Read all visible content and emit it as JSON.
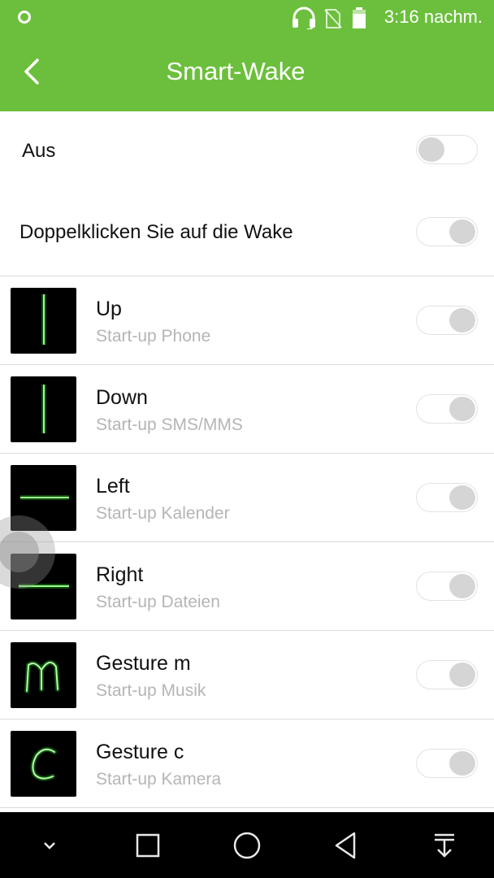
{
  "status_bar": {
    "time": "3:16 nachm.",
    "icons": [
      "notification-dot-icon",
      "headset-icon",
      "no-sim-icon",
      "battery-icon"
    ]
  },
  "app_bar": {
    "title": "Smart-Wake",
    "back_icon": "back-arrow-icon"
  },
  "settings": {
    "master": {
      "label": "Aus",
      "enabled": false
    },
    "double_click": {
      "label": "Doppelklicken Sie auf die Wake",
      "enabled": false
    }
  },
  "gestures": [
    {
      "title": "Up",
      "subtitle": "Start-up Phone",
      "thumb_icon": "vertical-line-gesture-icon",
      "enabled": false
    },
    {
      "title": "Down",
      "subtitle": "Start-up SMS/MMS",
      "thumb_icon": "vertical-line-gesture-icon",
      "enabled": false
    },
    {
      "title": "Left",
      "subtitle": "Start-up Kalender",
      "thumb_icon": "horizontal-line-gesture-icon",
      "enabled": false
    },
    {
      "title": "Right",
      "subtitle": "Start-up Dateien",
      "thumb_icon": "horizontal-line-gesture-icon",
      "enabled": false
    },
    {
      "title": "Gesture m",
      "subtitle": "Start-up Musik",
      "thumb_icon": "letter-m-gesture-icon",
      "enabled": false
    },
    {
      "title": "Gesture c",
      "subtitle": "Start-up Kamera",
      "thumb_icon": "letter-c-gesture-icon",
      "enabled": false
    }
  ],
  "nav_bar": {
    "icons": [
      "hide-nav-chevron-icon",
      "recents-square-icon",
      "home-circle-icon",
      "back-triangle-icon",
      "notification-pulldown-icon"
    ]
  },
  "colors": {
    "app_bar": "#6cbf3c",
    "gesture_glow": "#39ff3a",
    "nav_bar": "#000000"
  }
}
